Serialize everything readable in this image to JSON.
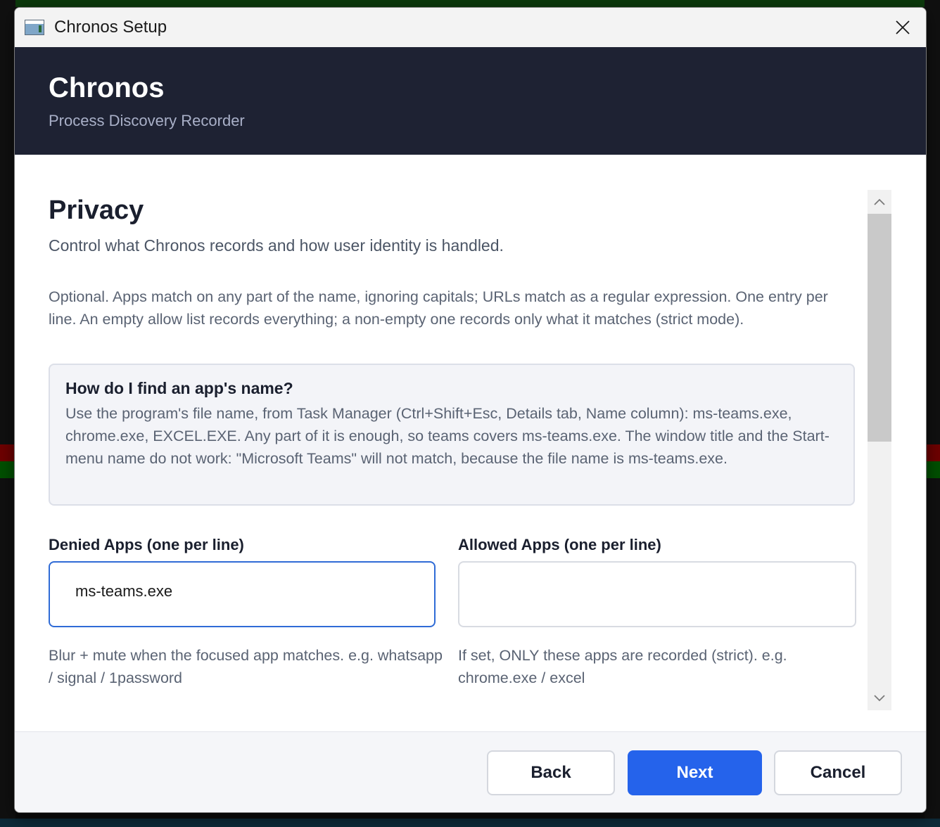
{
  "window": {
    "title": "Chronos Setup",
    "close_label": "close"
  },
  "header": {
    "brand": "Chronos",
    "subtitle": "Process Discovery Recorder"
  },
  "section": {
    "title": "Privacy",
    "subtitle": "Control what Chronos records and how user identity is handled.",
    "info": "Optional. Apps match on any part of the name, ignoring capitals; URLs match as a regular expression. One entry per line. An empty allow list records everything; a non-empty one records only what it matches (strict mode)."
  },
  "help": {
    "title": "How do I find an app's name?",
    "body": "Use the program's file name, from Task Manager (Ctrl+Shift+Esc, Details tab, Name column): ms-teams.exe, chrome.exe, EXCEL.EXE. Any part of it is enough, so teams covers ms-teams.exe. The window title and the Start-menu name do not work: \"Microsoft Teams\" will not match, because the file name is ms-teams.exe."
  },
  "denied_apps": {
    "label": "Denied Apps (one per line)",
    "value": "ms-teams.exe",
    "hint": "Blur + mute when the focused app matches. e.g. whatsapp  /  signal  /  1password"
  },
  "allowed_apps": {
    "label": "Allowed Apps (one per line)",
    "value": "",
    "hint": "If set, ONLY these apps are recorded (strict). e.g. chrome.exe  /  excel"
  },
  "footer": {
    "back_label": "Back",
    "next_label": "Next",
    "cancel_label": "Cancel"
  },
  "colors": {
    "header_bg": "#1e2233",
    "accent": "#2563eb",
    "focus_border": "#2f6bd6"
  },
  "icons": {
    "app": "window-app-icon",
    "close": "close-icon",
    "scroll_up": "chevron-up-icon",
    "scroll_down": "chevron-down-icon"
  }
}
